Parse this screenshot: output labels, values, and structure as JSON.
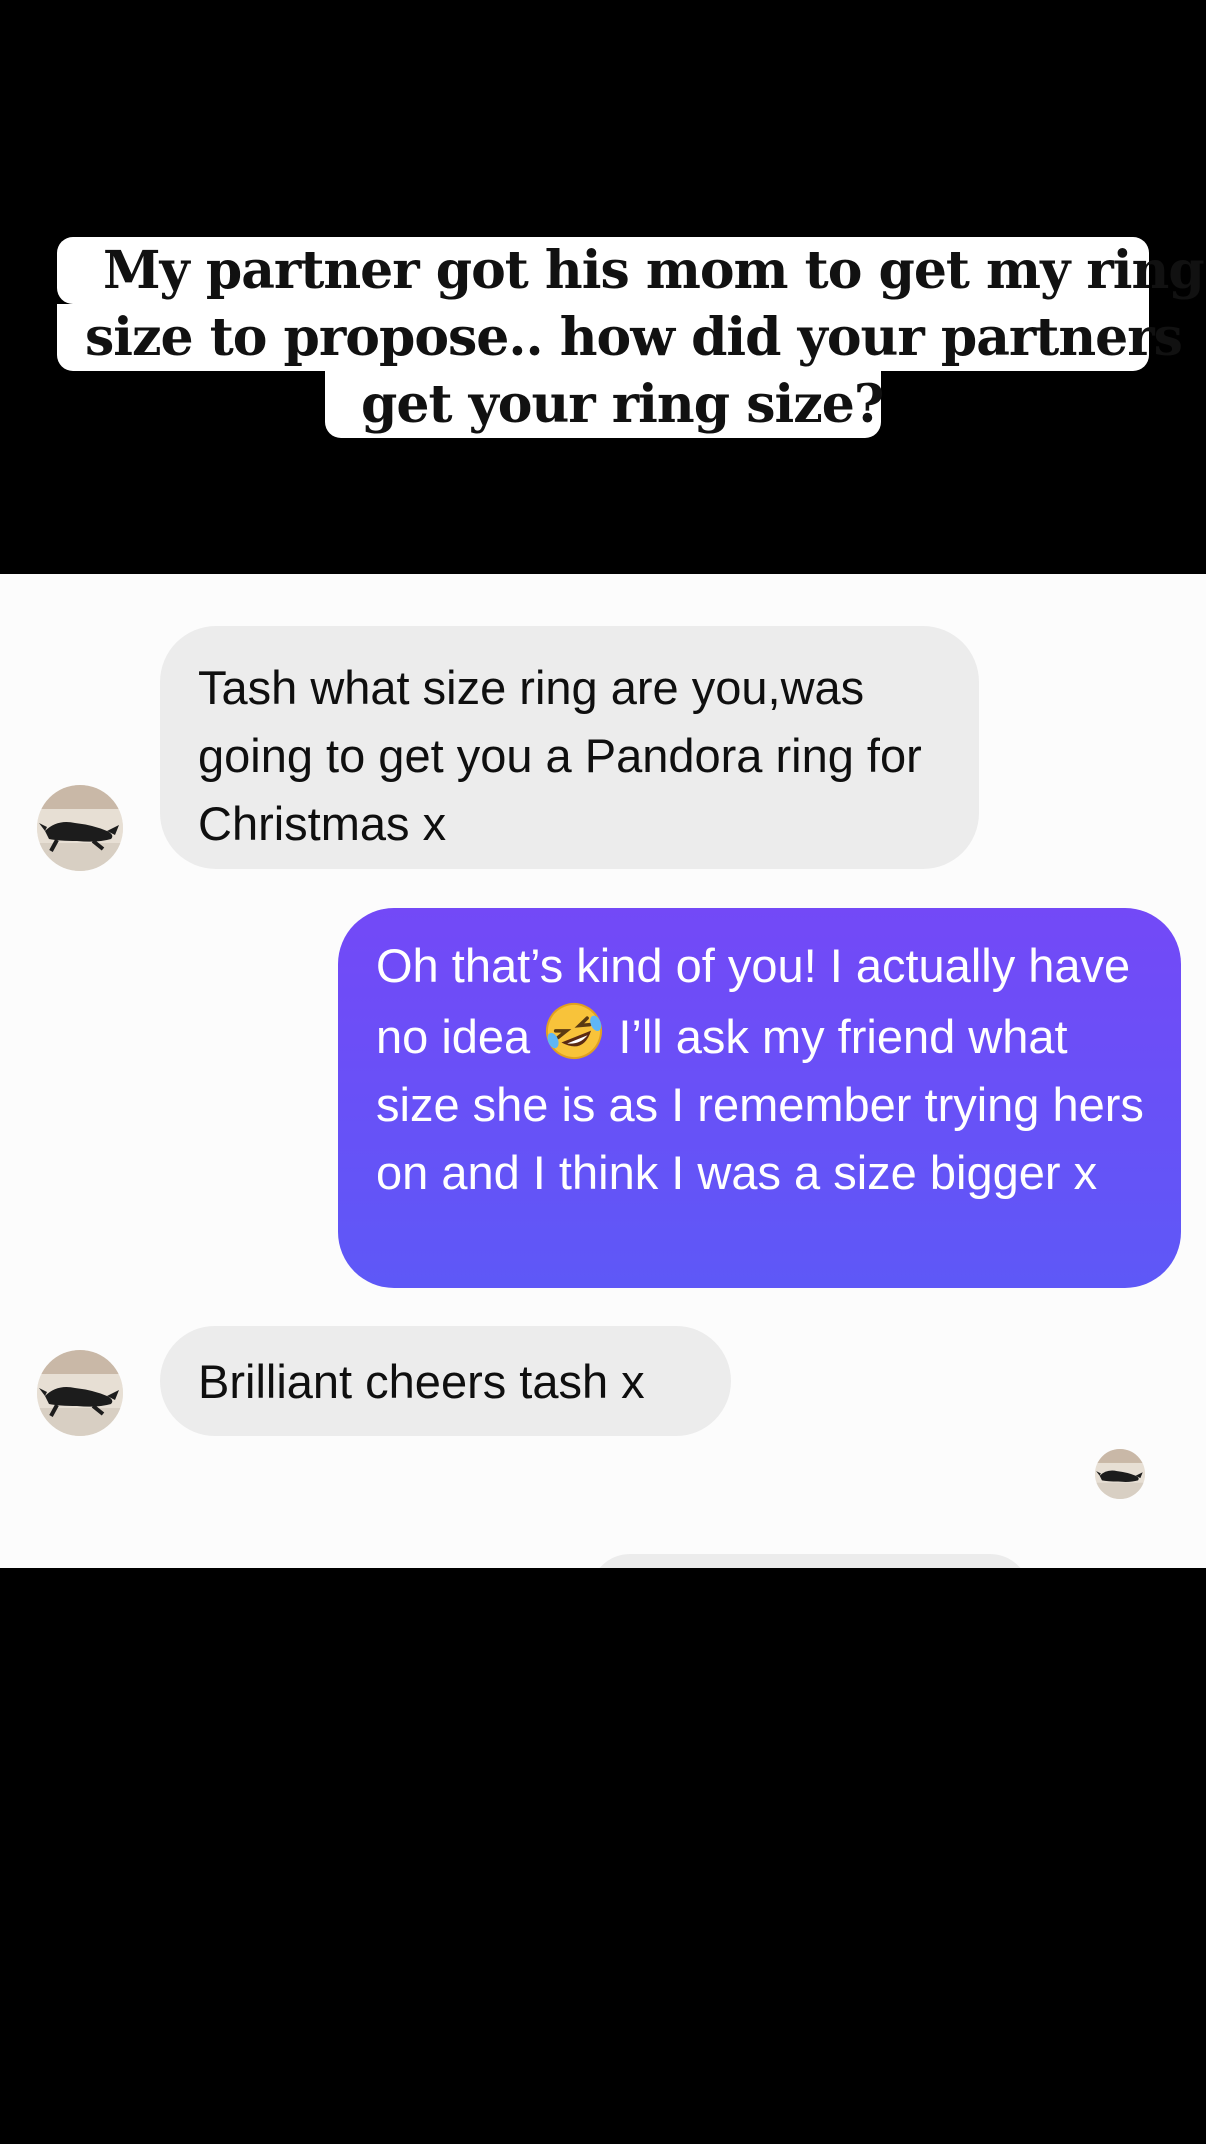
{
  "caption": {
    "lines": [
      "My partner got his mom to get my ring",
      "size to propose.. how did your partners",
      "get your ring size?"
    ]
  },
  "chat": {
    "messages": [
      {
        "direction": "incoming",
        "text": "Tash what size ring are you,was going to get you a Pandora ring for Christmas x"
      },
      {
        "direction": "outgoing",
        "text_before_emoji": "Oh that’s kind of you! I actually have no idea ",
        "emoji": "rolling-on-the-floor-laughing",
        "text_after_emoji": " I’ll ask my friend what size she is as I remember trying hers on and I think I was a size bigger x"
      },
      {
        "direction": "incoming",
        "text": "Brilliant cheers tash x"
      }
    ],
    "avatar_icon": "dog-photo-avatar",
    "colors": {
      "incoming_bubble": "#ececec",
      "outgoing_bubble_top": "#7349f7",
      "outgoing_bubble_bottom": "#5e58f7",
      "background": "#fcfcfc"
    }
  }
}
